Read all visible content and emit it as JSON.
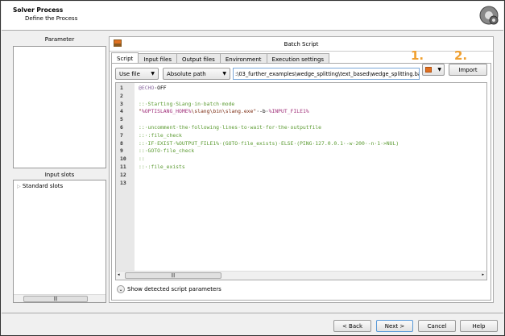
{
  "header": {
    "title": "Solver Process",
    "subtitle": "Define the Process",
    "icon": "gear-icon"
  },
  "left": {
    "parameter_label": "Parameter",
    "input_slots_label": "Input slots",
    "tree": [
      {
        "label": "Standard slots"
      }
    ]
  },
  "batch": {
    "title": "Batch Script",
    "icon": "script-icon",
    "tabs": [
      {
        "label": "Script",
        "active": true
      },
      {
        "label": "Input files"
      },
      {
        "label": "Output files"
      },
      {
        "label": "Environment"
      },
      {
        "label": "Execution settings"
      }
    ],
    "source_select": "Use file",
    "path_mode_select": "Absolute path",
    "path_value": ":\\03_further_examples\\wedge_splitting\\text_based\\wedge_splitting.bat",
    "import_label": "Import",
    "marker1": "1.",
    "marker2": "2.",
    "marker_color": "#f0a030",
    "lines": [
      {
        "n": "1",
        "segs": [
          {
            "c": "kw",
            "t": "@ECHO"
          },
          {
            "c": "",
            "t": "·OFF"
          }
        ]
      },
      {
        "n": "2",
        "segs": []
      },
      {
        "n": "3",
        "segs": [
          {
            "c": "cmt",
            "t": "::·Starting·SLang·in·batch·mode"
          }
        ]
      },
      {
        "n": "4",
        "segs": [
          {
            "c": "str",
            "t": "\""
          },
          {
            "c": "var",
            "t": "%OPTISLANG_HOME%"
          },
          {
            "c": "str",
            "t": "\\slang\\bin\\slang.exe\""
          },
          {
            "c": "",
            "t": "·-b·"
          },
          {
            "c": "var",
            "t": "%INPUT_FILE1%"
          }
        ]
      },
      {
        "n": "5",
        "segs": []
      },
      {
        "n": "6",
        "segs": [
          {
            "c": "cmt",
            "t": "::·uncomment·the·following·lines·to·wait·for·the·outputfile"
          }
        ]
      },
      {
        "n": "7",
        "segs": [
          {
            "c": "cmt",
            "t": "::·:file_check"
          }
        ]
      },
      {
        "n": "8",
        "segs": [
          {
            "c": "cmt",
            "t": "::·IF·EXIST·%OUTPUT_FILE1%·(GOTO·file_exists)·ELSE·(PING·127.0.0.1·-w·200·-n·1·>NUL)"
          }
        ]
      },
      {
        "n": "9",
        "segs": [
          {
            "c": "cmt",
            "t": "::·GOTO·file_check"
          }
        ]
      },
      {
        "n": "10",
        "segs": [
          {
            "c": "cmt",
            "t": "::"
          }
        ]
      },
      {
        "n": "11",
        "segs": [
          {
            "c": "cmt",
            "t": "::·:file_exists"
          }
        ]
      },
      {
        "n": "12",
        "segs": []
      },
      {
        "n": "13",
        "segs": []
      }
    ],
    "show_params_label": "Show detected script parameters"
  },
  "footer": {
    "back": "< Back",
    "next": "Next >",
    "cancel": "Cancel",
    "help": "Help"
  }
}
